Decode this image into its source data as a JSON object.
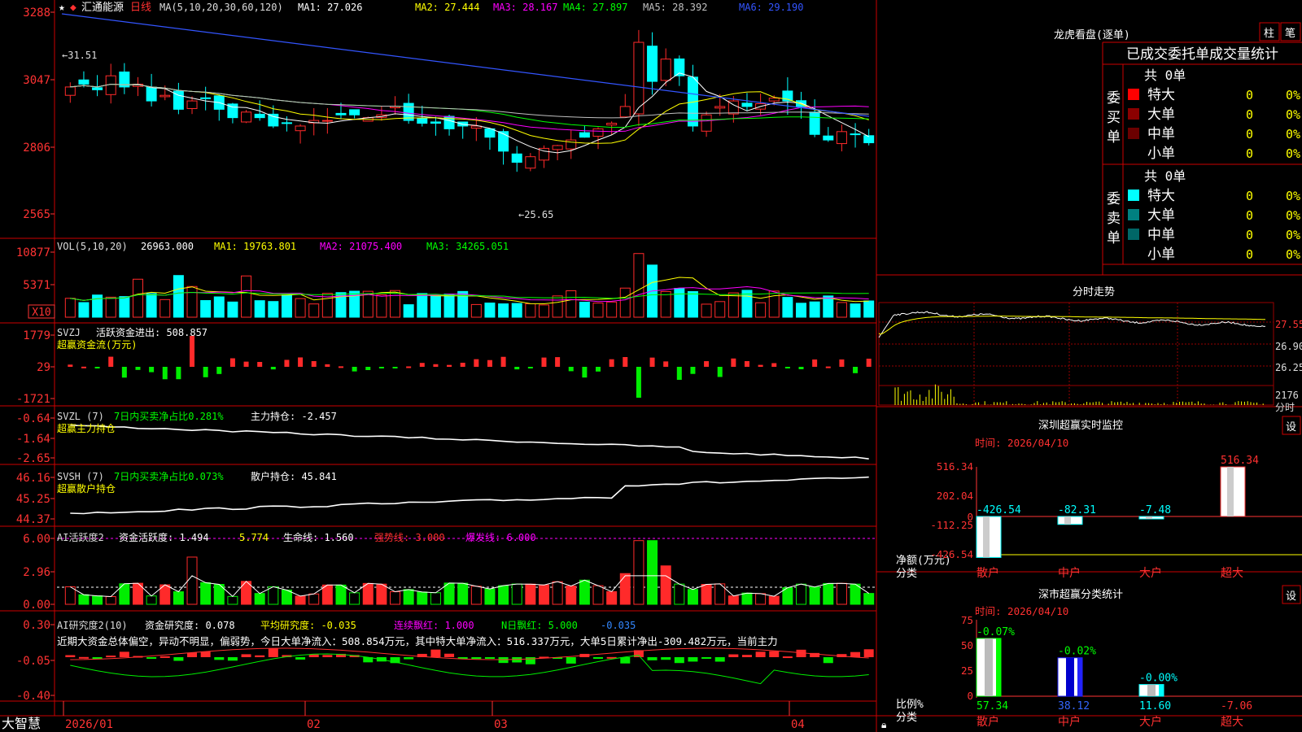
{
  "app": {
    "brand": "大智慧",
    "stock_name": "汇通能源",
    "period": "日线",
    "star": "★"
  },
  "colors": {
    "up": "#ff2a2a",
    "down": "#00ffff",
    "ma1": "#ffffff",
    "ma2": "#ffff00",
    "ma3": "#ff00ff",
    "ma4": "#00ff00",
    "ma5": "#c0c0c0",
    "ma6": "#3355ff",
    "grid": "#cc0000",
    "axis_text": "#ff3333",
    "green_bar": "#00ee00"
  },
  "price_panel": {
    "header": {
      "ma_label": "MA(5,10,20,30,60,120)",
      "ma1": "MA1: 27.026",
      "ma2": "MA2: 27.444",
      "ma3": "MA3: 28.167",
      "ma4": "MA4: 27.897",
      "ma5": "MA5: 28.392",
      "ma6": "MA6: 29.190"
    },
    "y_ticks": [
      "3288",
      "3047",
      "2806",
      "2565"
    ],
    "high_label": "31.51",
    "low_label": "25.65"
  },
  "vol_panel": {
    "header": {
      "label": "VOL(5,10,20)",
      "value": "26963.000",
      "ma1": "MA1: 19763.801",
      "ma2": "MA2: 21075.400",
      "ma3": "MA3: 34265.051"
    },
    "y_ticks": [
      "10877",
      "5371"
    ],
    "unit": "X10"
  },
  "svzj_panel": {
    "header": {
      "name": "SVZJ",
      "label": "活跃资金进出: 508.857"
    },
    "subtitle": "超赢资金流(万元)",
    "y_ticks": [
      "1779",
      "29",
      "-1721"
    ]
  },
  "svzl_panel": {
    "header": {
      "name": "SVZL (7)",
      "label1": "7日内买卖净占比0.281%",
      "label2": "主力持仓: -2.457"
    },
    "subtitle": "超赢主力持仓",
    "y_ticks": [
      "-0.64",
      "-1.64",
      "-2.65"
    ]
  },
  "svsh_panel": {
    "header": {
      "name": "SVSH (7)",
      "label1": "7日内买卖净占比0.073%",
      "label2": "散户持仓: 45.841"
    },
    "subtitle": "超赢散户持仓",
    "y_ticks": [
      "46.16",
      "45.25",
      "44.37"
    ]
  },
  "ai_active_panel": {
    "header": {
      "name": "AI活跃度2",
      "l1": "资金活跃度: 1.494",
      "l2": "5.774",
      "l3": "生命线: 1.560",
      "l4": "强势线: 3.000",
      "l5": "爆发线: 6.000"
    },
    "y_ticks": [
      "6.00",
      "2.96",
      "0.00"
    ]
  },
  "ai_research_panel": {
    "header": {
      "name": "AI研究度2(10)",
      "l1": "资金研究度: 0.078",
      "l2": "平均研究度: -0.035",
      "l3": "连续飘红: 1.000",
      "l4": "N日飘红: 5.000",
      "l5": "-0.035"
    },
    "comment": "近期大资金总体偏空，异动不明显，偏弱势，今日大单净流入：508.854万元，其中特大单净流入：516.337万元，大单5日累计净出-309.482万元，当前主力",
    "y_ticks": [
      "0.30",
      "-0.05",
      "-0.40"
    ]
  },
  "x_axis": {
    "labels": [
      "2026/01",
      "02",
      "03",
      "04"
    ]
  },
  "right": {
    "dragon_tiger": {
      "title": "龙虎看盘(逐单)",
      "tab1": "柱",
      "tab2": "笔",
      "subtitle": "已成交委托单成交量统计",
      "buy": {
        "side": "委买单",
        "total": "共 0单",
        "rows": [
          {
            "label": "特大",
            "count": "0",
            "pct": "0%"
          },
          {
            "label": "大单",
            "count": "0",
            "pct": "0%"
          },
          {
            "label": "中单",
            "count": "0",
            "pct": "0%"
          },
          {
            "label": "小单",
            "count": "0",
            "pct": "0%"
          }
        ]
      },
      "sell": {
        "side": "委卖单",
        "total": "共 0单",
        "rows": [
          {
            "label": "特大",
            "count": "0",
            "pct": "0%"
          },
          {
            "label": "大单",
            "count": "0",
            "pct": "0%"
          },
          {
            "label": "中单",
            "count": "0",
            "pct": "0%"
          },
          {
            "label": "小单",
            "count": "0",
            "pct": "0%"
          }
        ]
      }
    },
    "intraday": {
      "title": "分时走势",
      "y_ticks": [
        "27.55",
        "26.90",
        "26.25"
      ],
      "vol_tick": "2176",
      "vol_unit": "分时"
    },
    "monitor": {
      "title": "深圳超赢实时监控",
      "setting": "设",
      "time": "时间: 2026/04/10",
      "y_ticks": [
        "516.34",
        "202.04",
        "-112.25",
        "-426.54"
      ],
      "zero": "0",
      "unit_line1": "净额(万元)",
      "unit_line2": "分类",
      "categories": [
        "散户",
        "中户",
        "大户",
        "超大"
      ],
      "values": [
        -426.54,
        -82.31,
        -7.48,
        516.34
      ],
      "value_labels": [
        "-426.54",
        "-82.31",
        "-7.48",
        "516.34"
      ]
    },
    "classify": {
      "title": "深市超赢分类统计",
      "setting": "设",
      "time": "时间: 2026/04/10",
      "y_ticks": [
        "75",
        "50",
        "25",
        "0"
      ],
      "unit_line1": "比例%",
      "unit_line2": "分类",
      "categories": [
        "散户",
        "中户",
        "大户",
        "超大"
      ],
      "top_labels": [
        "-0.07%",
        "-0.02%",
        "-0.00%",
        ""
      ],
      "values": [
        57.34,
        38.12,
        11.6,
        -7.06
      ],
      "value_labels": [
        "57.34",
        "38.12",
        "11.60",
        "-7.06"
      ]
    }
  }
}
